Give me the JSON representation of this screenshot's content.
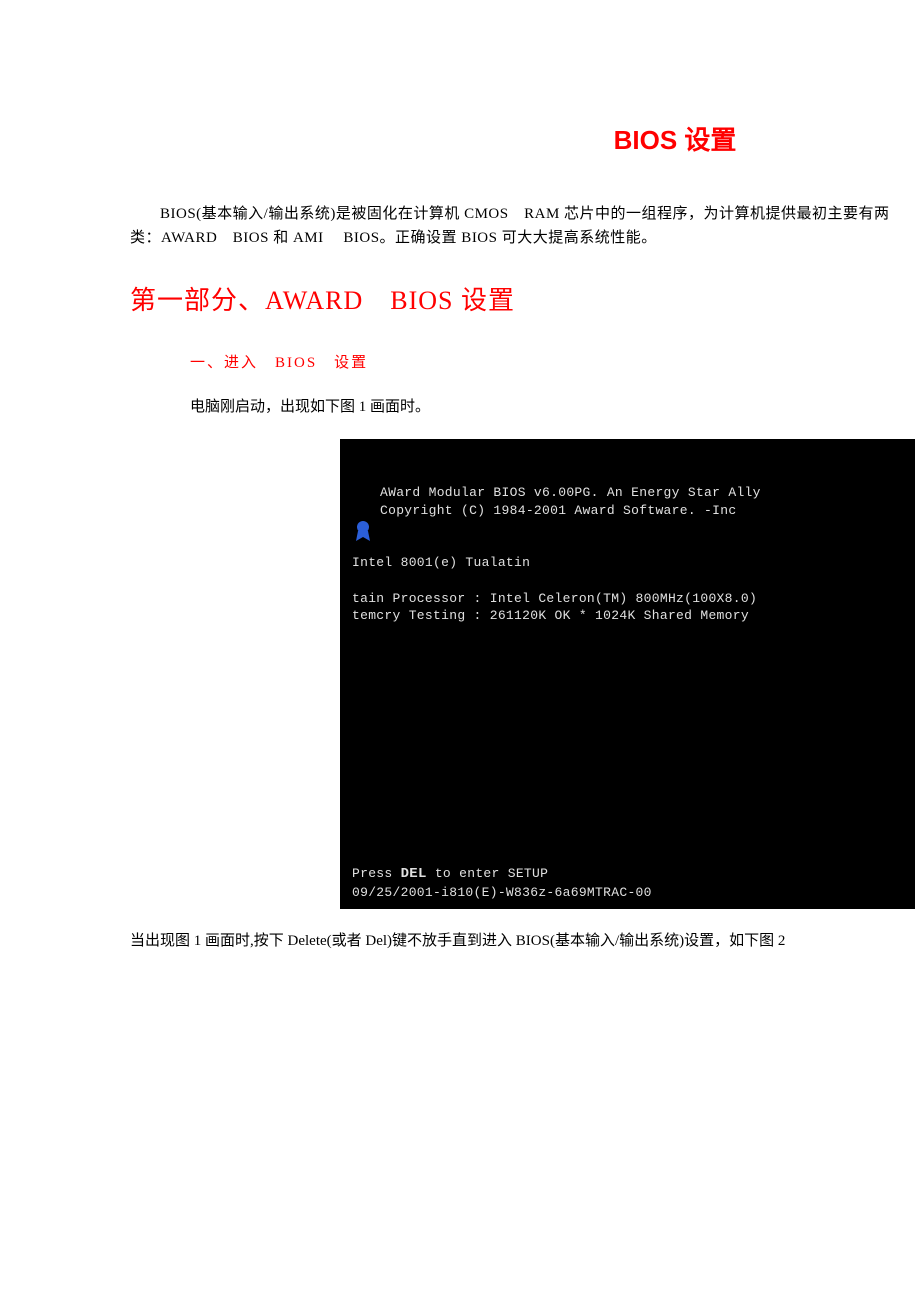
{
  "title": "BIOS 设置",
  "intro": "BIOS(基本输入/输出系统)是被固化在计算机 CMOS　RAM 芯片中的一组程序，为计算机提供最初主要有两类：AWARD　BIOS 和 AMI 　BIOS。正确设置 BIOS 可大大提高系统性能。",
  "section1_heading": "第一部分、AWARD　BIOS 设置",
  "sub1": "一、进入　BIOS　设置",
  "p1": "电脑刚启动，出现如下图 1 画面时。",
  "bios": {
    "line1": "AWard Modular BIOS v6.00PG. An Energy Star Ally",
    "line2": "Copyright (C) 1984-2001 Award Software. -Inc",
    "line3": "Intel 8001(e) Tualatin",
    "line4": "tain Processor : Intel Celeron(TM) 800MHz(100X8.0)",
    "line5": "temcry Testing : 261120K OK * 1024K Shared Memory",
    "press_prefix": "Press ",
    "press_key": "DEL",
    "press_suffix": " to enter SETUP",
    "datecode": "09/25/2001-i810(E)-W836z-6a69MTRAC-00"
  },
  "energy_label": "energy",
  "p2": "当出现图 1 画面时,按下 Delete(或者 Del)键不放手直到进入 BIOS(基本输入/输出系统)设置，如下图 2"
}
